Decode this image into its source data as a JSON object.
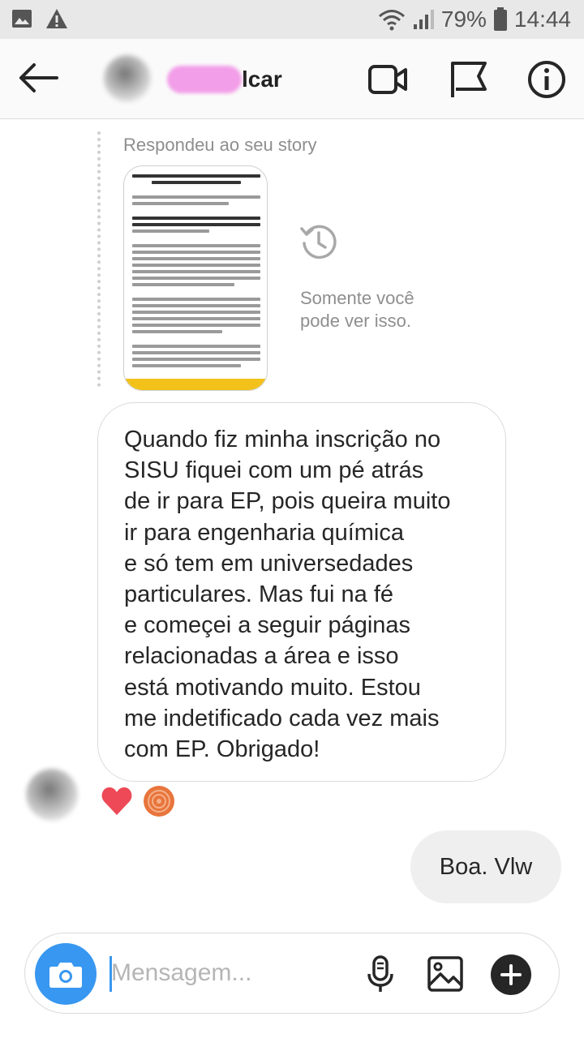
{
  "status_bar": {
    "battery": "79%",
    "time": "14:44"
  },
  "header": {
    "contact_name_visible": "lcar"
  },
  "story_reply": {
    "caption": "Respondeu ao seu story",
    "only_you_line1": "Somente você",
    "only_you_line2": "pode ver isso."
  },
  "messages": {
    "incoming": "Quando fiz minha inscrição no\nSISU fiquei com um pé atrás\nde ir para EP, pois queira muito\nir para engenharia química\ne só tem em universedades\nparticulares. Mas fui na fé\ne começei a seguir páginas\nrelacionadas a área e isso\nestá motivando muito. Estou\nme indetificado cada vez mais\ncom EP. Obrigado!",
    "outgoing": "Boa. Vlw"
  },
  "reactions": [
    "heart",
    "avatar"
  ],
  "composer": {
    "placeholder": "Mensagem..."
  },
  "colors": {
    "accent": "#3897f0",
    "heart": "#ed4956",
    "reaction_avatar": "#e8753c"
  },
  "icons": [
    "picture-icon",
    "warning-icon",
    "wifi-icon",
    "signal-icon",
    "battery-icon",
    "back-arrow-icon",
    "video-call-icon",
    "flag-icon",
    "info-icon",
    "history-icon",
    "camera-icon",
    "microphone-icon",
    "gallery-icon",
    "plus-icon"
  ]
}
